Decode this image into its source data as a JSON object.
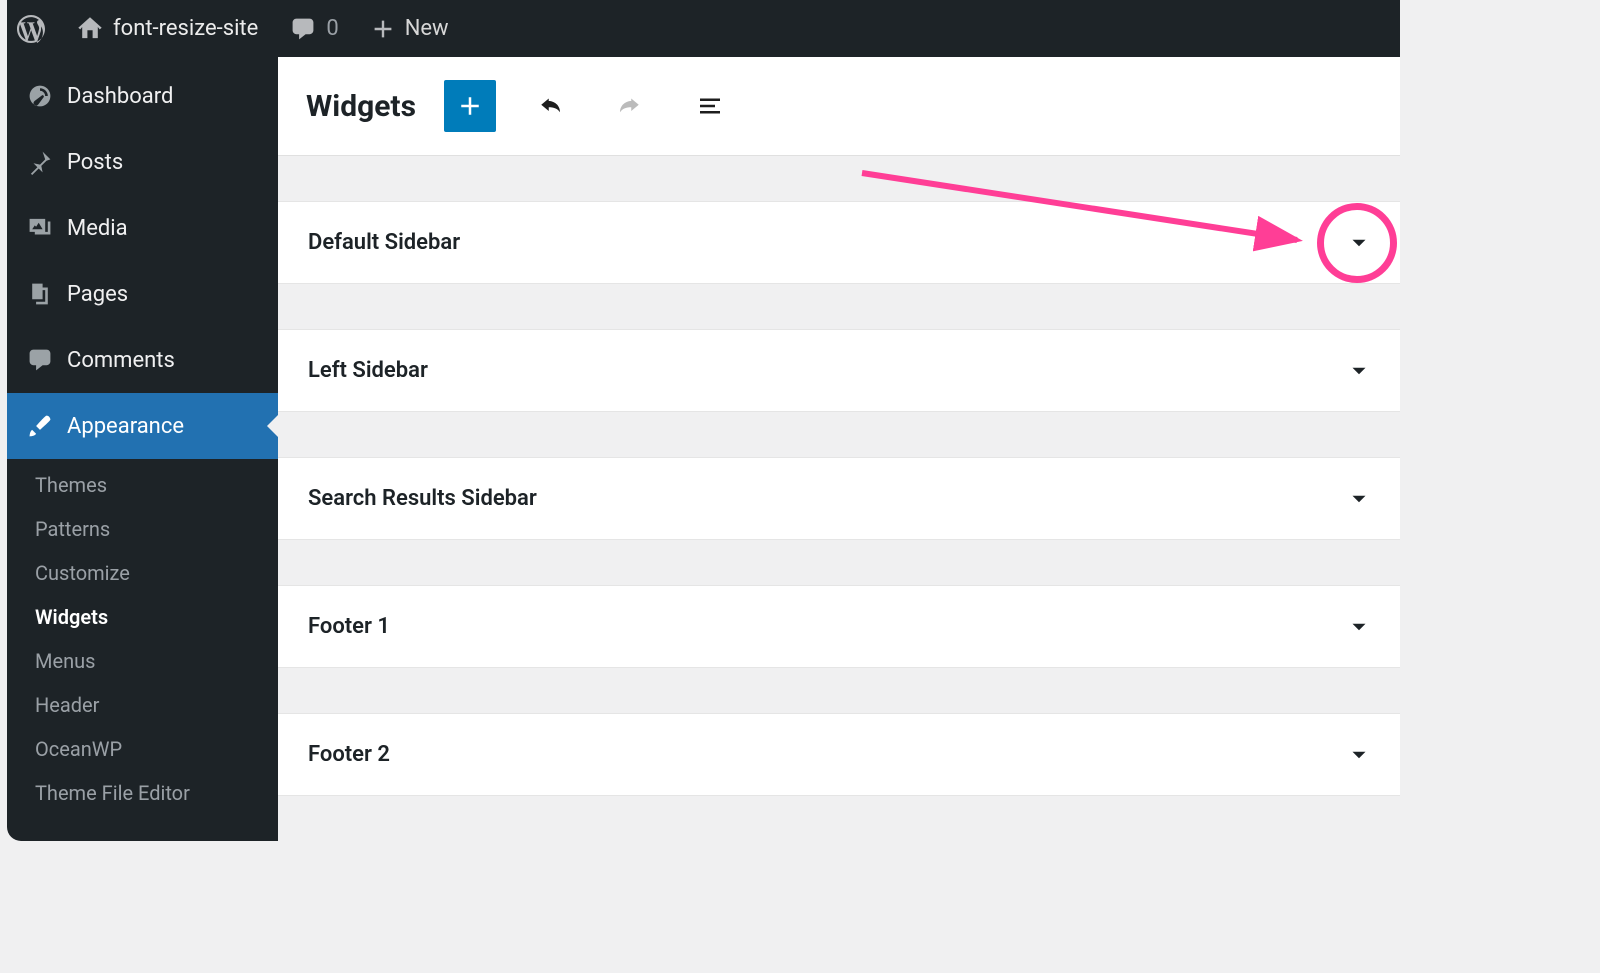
{
  "adminbar": {
    "site_name": "font-resize-site",
    "comments_count": "0",
    "new_label": "New"
  },
  "sidebar": {
    "dashboard": "Dashboard",
    "posts": "Posts",
    "media": "Media",
    "pages": "Pages",
    "comments": "Comments",
    "appearance": "Appearance",
    "sub": {
      "themes": "Themes",
      "patterns": "Patterns",
      "customize": "Customize",
      "widgets": "Widgets",
      "menus": "Menus",
      "header": "Header",
      "oceanwp": "OceanWP",
      "theme_file_editor": "Theme File Editor"
    }
  },
  "header": {
    "title": "Widgets"
  },
  "panels": [
    {
      "title": "Default Sidebar"
    },
    {
      "title": "Left Sidebar"
    },
    {
      "title": "Search Results Sidebar"
    },
    {
      "title": "Footer 1"
    },
    {
      "title": "Footer 2"
    }
  ],
  "annotation": {
    "color": "#ff3e96"
  }
}
